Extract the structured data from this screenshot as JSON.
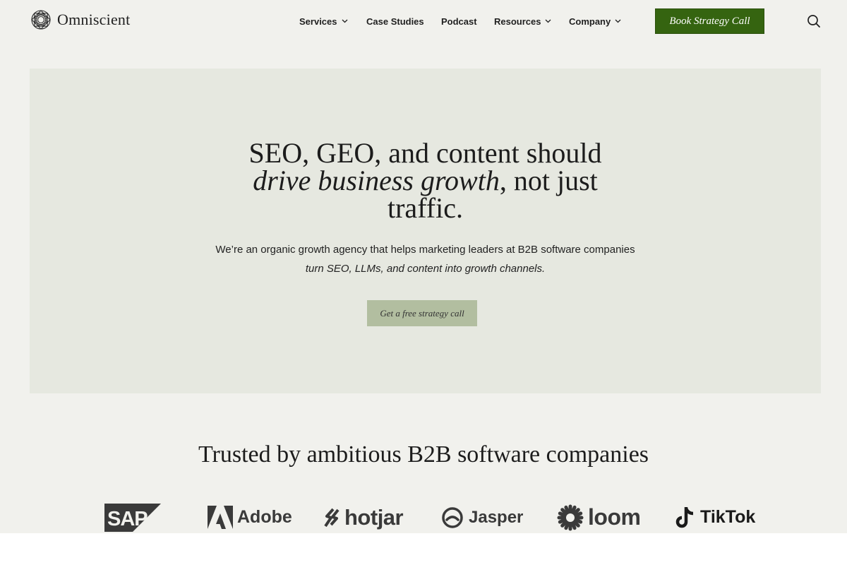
{
  "brand": {
    "name": "Omniscient"
  },
  "nav": {
    "items": [
      {
        "label": "Services",
        "has_dropdown": true
      },
      {
        "label": "Case Studies",
        "has_dropdown": false
      },
      {
        "label": "Podcast",
        "has_dropdown": false
      },
      {
        "label": "Resources",
        "has_dropdown": true
      },
      {
        "label": "Company",
        "has_dropdown": true
      }
    ],
    "cta_label": "Book Strategy Call",
    "search_icon": "search-icon"
  },
  "hero": {
    "title_line1": "SEO, GEO, and content should",
    "title_emphasis": "drive business growth",
    "title_rest": ", not just",
    "title_line3": "traffic.",
    "subtitle_line1": "We’re an organic growth agency that helps marketing leaders at B2B software companies",
    "subtitle_line2": "turn SEO, LLMs, and content into growth channels.",
    "button_label": "Get a free strategy call"
  },
  "trusted": {
    "heading": "Trusted by ambitious B2B software companies",
    "logos": [
      "SAP",
      "Adobe",
      "hotjar",
      "Jasper",
      "loom",
      "TikTok"
    ]
  },
  "colors": {
    "page_bg": "#f1f1ed",
    "hero_bg": "#e6e8e0",
    "cta_bg": "#356410",
    "hero_button_bg": "#b2bea0"
  }
}
